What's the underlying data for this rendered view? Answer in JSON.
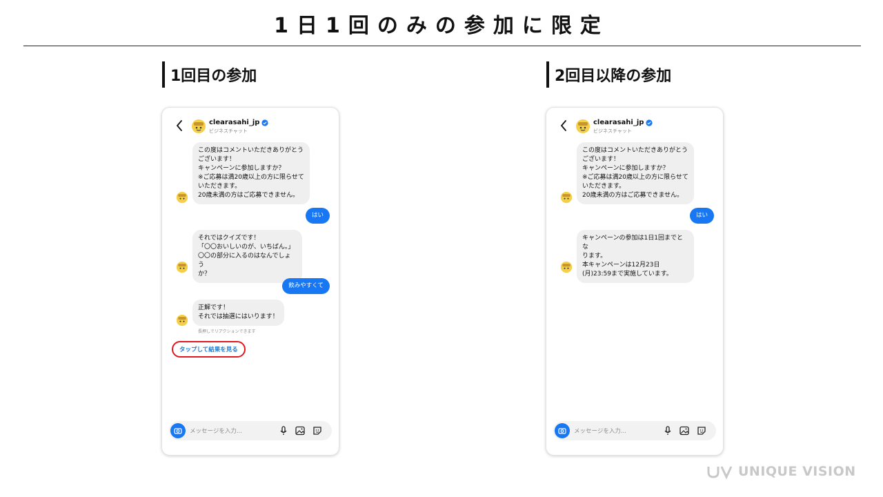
{
  "slide": {
    "title": "1日1回のみの参加に限定",
    "left_heading": "1回目の参加",
    "right_heading": "2回目以降の参加"
  },
  "colors": {
    "accent_blue": "#1877f2",
    "highlight_red": "#e3181f",
    "bubble_gray": "#efefef",
    "link_blue": "#1e7bd6"
  },
  "left_phone": {
    "account_name": "clearasahi_jp",
    "account_sub": "ビジネスチャット",
    "msg1": "この度はコメントいただきありがとう\nございます！\nキャンペーンに参加しますか？\n※ご応募は満20歳以上の方に限らせて\nいただきます。\n20歳未満の方はご応募できません。",
    "reply1": "はい",
    "msg2": "それではクイズです！\n「〇〇おいしいのが、いちばん。」\n〇〇の部分に入るのはなんでしょう\nか？",
    "reply2": "飲みやすくて",
    "msg3": "正解です！\nそれでは抽選にはいります！",
    "reaction_hint": "長押しでリアクションできます",
    "result_button": "タップして結果を見る",
    "input_placeholder": "メッセージを入力..."
  },
  "right_phone": {
    "account_name": "clearasahi_jp",
    "account_sub": "ビジネスチャット",
    "msg1": "この度はコメントいただきありがとう\nございます！\nキャンペーンに参加しますか？\n※ご応募は満20歳以上の方に限らせて\nいただきます。\n20歳未満の方はご応募できません。",
    "reply1": "はい",
    "msg2": "キャンペーンの参加は1日1回までとな\nります。\n本キャンペーンは12月23日\n(月)23:59まで実施しています。",
    "input_placeholder": "メッセージを入力..."
  },
  "icons": {
    "back": "chevron-left-icon",
    "verified": "verified-badge-icon",
    "camera": "camera-icon",
    "mic": "microphone-icon",
    "image": "image-icon",
    "sticker": "sticker-icon"
  },
  "logo": {
    "text": "UNIQUE VISION"
  }
}
